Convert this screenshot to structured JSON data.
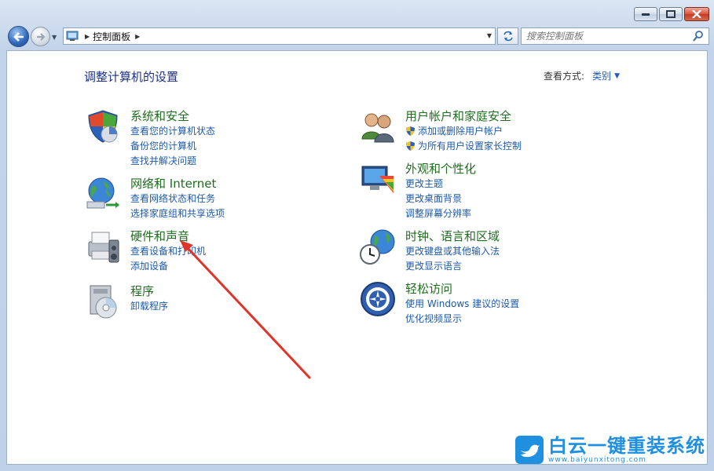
{
  "window": {
    "caption_buttons": [
      "minimize",
      "maximize",
      "close"
    ]
  },
  "toolbar": {
    "address_crumbs": [
      "控制面板"
    ],
    "search_placeholder": "搜索控制面板"
  },
  "main": {
    "title": "调整计算机的设置",
    "view_by_label": "查看方式:",
    "view_by_value": "类别"
  },
  "categories_left": [
    {
      "icon": "security-shield-icon",
      "title": "系统和安全",
      "links": [
        {
          "label": "查看您的计算机状态"
        },
        {
          "label": "备份您的计算机"
        },
        {
          "label": "查找并解决问题"
        }
      ]
    },
    {
      "icon": "network-globe-icon",
      "title": "网络和 Internet",
      "links": [
        {
          "label": "查看网络状态和任务"
        },
        {
          "label": "选择家庭组和共享选项"
        }
      ]
    },
    {
      "icon": "printer-speaker-icon",
      "title": "硬件和声音",
      "links": [
        {
          "label": "查看设备和打印机"
        },
        {
          "label": "添加设备"
        }
      ]
    },
    {
      "icon": "programs-disc-icon",
      "title": "程序",
      "links": [
        {
          "label": "卸载程序"
        }
      ]
    }
  ],
  "categories_right": [
    {
      "icon": "users-icon",
      "title": "用户帐户和家庭安全",
      "links": [
        {
          "label": "添加或删除用户帐户",
          "shield": true
        },
        {
          "label": "为所有用户设置家长控制",
          "shield": true
        }
      ]
    },
    {
      "icon": "appearance-monitor-icon",
      "title": "外观和个性化",
      "links": [
        {
          "label": "更改主题"
        },
        {
          "label": "更改桌面背景"
        },
        {
          "label": "调整屏幕分辨率"
        }
      ]
    },
    {
      "icon": "clock-globe-icon",
      "title": "时钟、语言和区域",
      "links": [
        {
          "label": "更改键盘或其他输入法"
        },
        {
          "label": "更改显示语言"
        }
      ]
    },
    {
      "icon": "ease-of-access-icon",
      "title": "轻松访问",
      "links": [
        {
          "label": "使用 Windows 建议的设置"
        },
        {
          "label": "优化视频显示"
        }
      ]
    }
  ],
  "watermark": {
    "name": "白云一键重装系统",
    "url": "www.baiyunxitong.com"
  },
  "colors": {
    "category_title": "#1f6d1f",
    "link": "#1e5aa8",
    "page_title": "#1e3287",
    "annotation_arrow": "#e0342b",
    "watermark": "#1f8fe0"
  }
}
